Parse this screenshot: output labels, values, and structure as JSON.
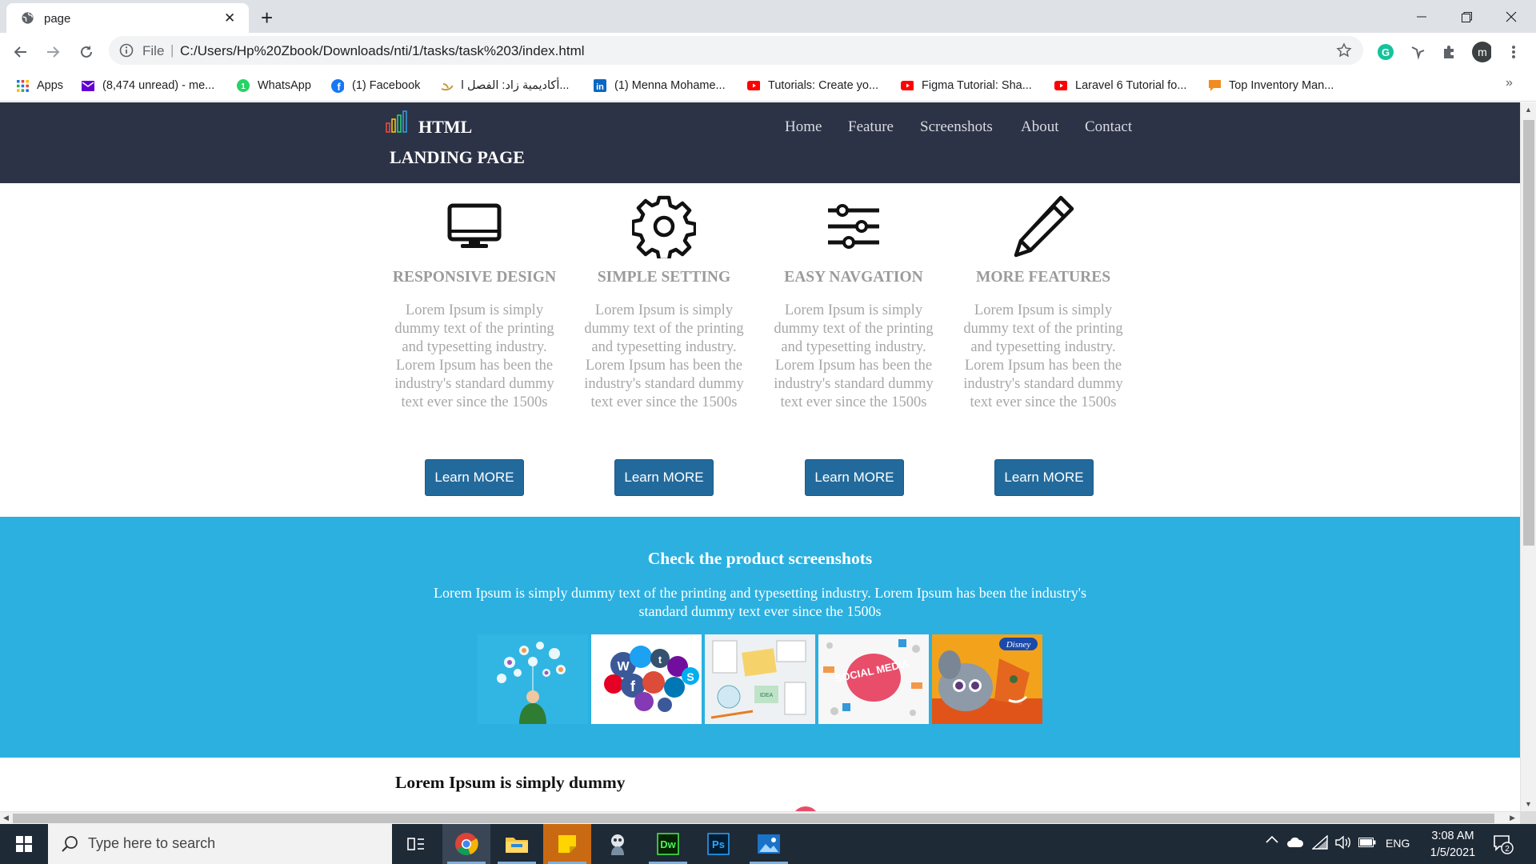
{
  "browser": {
    "tab_title": "page",
    "scheme_label": "File",
    "url": "C:/Users/Hp%20Zbook/Downloads/nti/1/tasks/task%203/index.html",
    "profile_initial": "m",
    "bookmarks": [
      {
        "label": "Apps",
        "icon": "apps-grid-icon"
      },
      {
        "label": "(8,474 unread) - me...",
        "icon": "mail-icon"
      },
      {
        "label": "WhatsApp",
        "icon": "whatsapp-icon"
      },
      {
        "label": "(1) Facebook",
        "icon": "facebook-icon"
      },
      {
        "label": "أكاديمية زاد: الفصل ا...",
        "icon": "zad-icon"
      },
      {
        "label": "(1) Menna Mohame...",
        "icon": "linkedin-icon"
      },
      {
        "label": "Tutorials: Create yo...",
        "icon": "youtube-icon"
      },
      {
        "label": "Figma Tutorial: Sha...",
        "icon": "youtube-icon"
      },
      {
        "label": "Laravel 6 Tutorial fo...",
        "icon": "youtube-icon"
      },
      {
        "label": "Top Inventory Man...",
        "icon": "chat-icon"
      }
    ],
    "bookmarks_overflow": "»"
  },
  "site": {
    "logo_line1": "HTML",
    "logo_line2": "LANDING PAGE",
    "nav": [
      "Home",
      "Feature",
      "Screenshots",
      "About",
      "Contact"
    ],
    "features": [
      {
        "icon": "monitor-icon",
        "title": "RESPONSIVE DESIGN",
        "text": "Lorem Ipsum is simply dummy text of the printing and typesetting industry. Lorem Ipsum has been the industry's standard dummy text ever since the 1500s",
        "button": "Learn MORE"
      },
      {
        "icon": "gear-icon",
        "title": "SIMPLE SETTING",
        "text": "Lorem Ipsum is simply dummy text of the printing and typesetting industry. Lorem Ipsum has been the industry's standard dummy text ever since the 1500s",
        "button": "Learn MORE"
      },
      {
        "icon": "sliders-icon",
        "title": "EASY NAVGATION",
        "text": "Lorem Ipsum is simply dummy text of the printing and typesetting industry. Lorem Ipsum has been the industry's standard dummy text ever since the 1500s",
        "button": "Learn MORE"
      },
      {
        "icon": "pencil-icon",
        "title": "MORE FEATURES",
        "text": "Lorem Ipsum is simply dummy text of the printing and typesetting industry. Lorem Ipsum has been the industry's standard dummy text ever since the 1500s",
        "button": "Learn MORE"
      }
    ],
    "screens_title": "Check the product screenshots",
    "screens_text": "Lorem Ipsum is simply dummy text of the printing and typesetting industry. Lorem Ipsum has been the industry's standard dummy text ever since the 1500s",
    "screenshot_badge": "Disney",
    "social_media_label": "SOCIAL MEDIA",
    "bottom_title": "Lorem Ipsum is simply dummy"
  },
  "taskbar": {
    "search_placeholder": "Type here to search",
    "language": "ENG",
    "time": "3:08 AM",
    "date": "1/5/2021",
    "notification_count": "2"
  },
  "colors": {
    "header_bg": "#2c3347",
    "button_bg": "#226a9c",
    "screens_bg": "#2bb0e0",
    "taskbar_bg": "#1f2a37"
  }
}
